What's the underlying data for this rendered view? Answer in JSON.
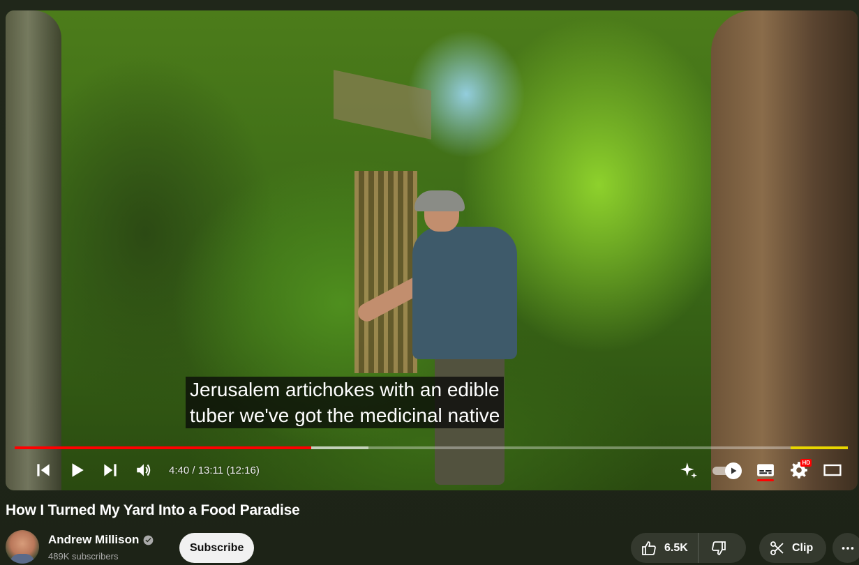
{
  "video": {
    "title": "How I Turned My Yard Into a Food Paradise",
    "captions": [
      "Jerusalem artichokes with an edible",
      "tuber we've got the medicinal native"
    ],
    "progress": {
      "played_fraction": 0.356,
      "buffered_fraction": 0.425
    },
    "time_display": "4:40 / 13:11 (12:16)",
    "settings_badge": "HD"
  },
  "controls": {
    "previous_icon": "skip-previous-icon",
    "play_icon": "play-icon",
    "next_icon": "skip-next-icon",
    "volume_icon": "volume-icon",
    "ai_icon": "sparkle-icon",
    "autoplay_icon": "autoplay-toggle-icon",
    "captions_icon": "subtitles-icon",
    "settings_icon": "gear-icon",
    "theater_icon": "theater-mode-icon"
  },
  "channel": {
    "name": "Andrew Millison",
    "subscribers": "489K subscribers",
    "subscribe_label": "Subscribe"
  },
  "actions": {
    "like_count": "6.5K",
    "clip_label": "Clip"
  },
  "colors": {
    "progress_played": "#ff0000",
    "segment_marker": "#e8d600",
    "background": "#1e2218"
  }
}
